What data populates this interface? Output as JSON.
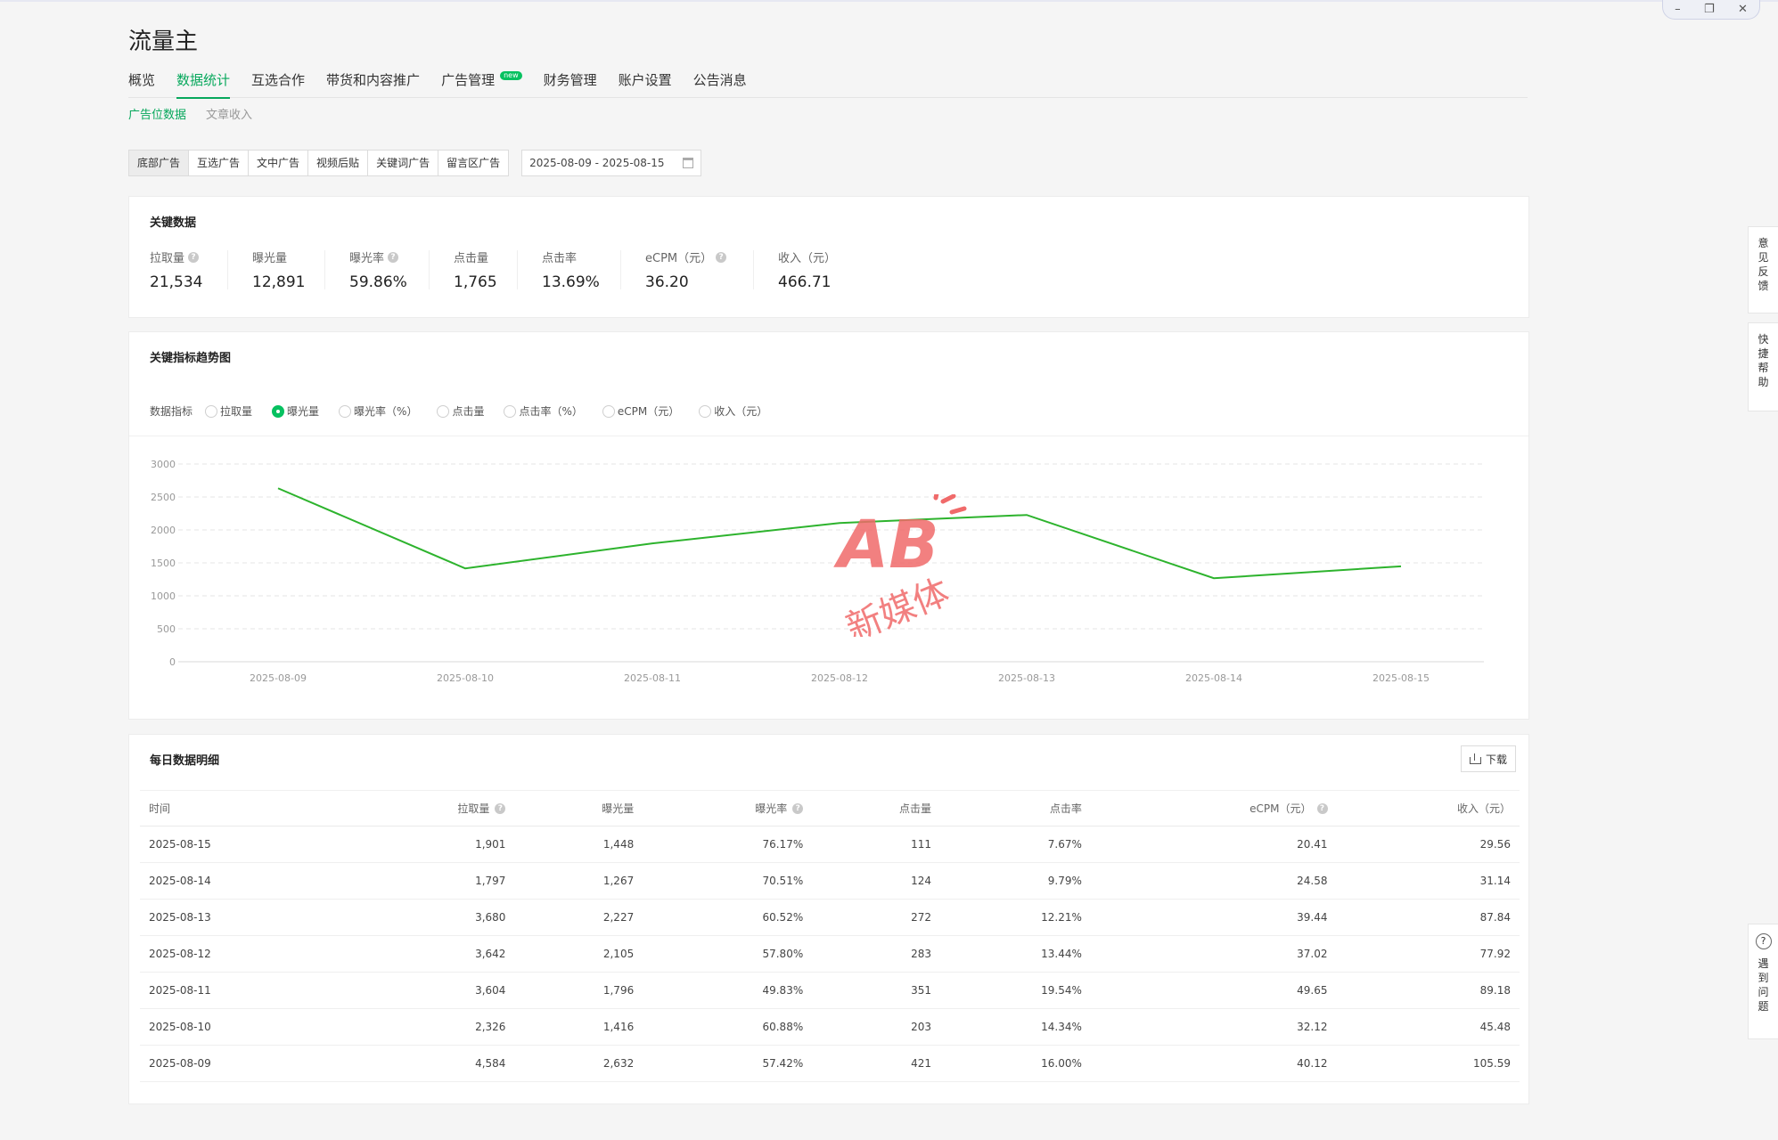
{
  "app": {
    "title": "流量主"
  },
  "main_tabs": [
    {
      "label": "概览",
      "active": false
    },
    {
      "label": "数据统计",
      "active": true
    },
    {
      "label": "互选合作",
      "active": false
    },
    {
      "label": "带货和内容推广",
      "active": false
    },
    {
      "label": "广告管理",
      "active": false,
      "badge": "new"
    },
    {
      "label": "财务管理",
      "active": false
    },
    {
      "label": "账户设置",
      "active": false
    },
    {
      "label": "公告消息",
      "active": false
    }
  ],
  "sub_tabs": [
    {
      "label": "广告位数据",
      "active": true
    },
    {
      "label": "文章收入",
      "active": false
    }
  ],
  "ad_types": [
    {
      "label": "底部广告",
      "active": true
    },
    {
      "label": "互选广告",
      "active": false
    },
    {
      "label": "文中广告",
      "active": false
    },
    {
      "label": "视频后贴",
      "active": false
    },
    {
      "label": "关键词广告",
      "active": false
    },
    {
      "label": "留言区广告",
      "active": false
    }
  ],
  "date_range": "2025-08-09 - 2025-08-15",
  "key_data": {
    "title": "关键数据",
    "items": [
      {
        "label": "拉取量",
        "value": "21,534",
        "help": true
      },
      {
        "label": "曝光量",
        "value": "12,891",
        "help": false
      },
      {
        "label": "曝光率",
        "value": "59.86%",
        "help": true
      },
      {
        "label": "点击量",
        "value": "1,765",
        "help": false
      },
      {
        "label": "点击率",
        "value": "13.69%",
        "help": false
      },
      {
        "label": "eCPM（元）",
        "value": "36.20",
        "help": true
      },
      {
        "label": "收入（元）",
        "value": "466.71",
        "help": false
      }
    ]
  },
  "trend": {
    "title": "关键指标趋势图",
    "metric_label": "数据指标",
    "metrics": [
      {
        "label": "拉取量",
        "checked": false
      },
      {
        "label": "曝光量",
        "checked": true
      },
      {
        "label": "曝光率（%）",
        "checked": false
      },
      {
        "label": "点击量",
        "checked": false
      },
      {
        "label": "点击率（%）",
        "checked": false
      },
      {
        "label": "eCPM（元）",
        "checked": false
      },
      {
        "label": "收入（元）",
        "checked": false
      }
    ]
  },
  "chart_data": {
    "type": "line",
    "x": [
      "2025-08-09",
      "2025-08-10",
      "2025-08-11",
      "2025-08-12",
      "2025-08-13",
      "2025-08-14",
      "2025-08-15"
    ],
    "series": [
      {
        "values": [
          2632,
          1416,
          1796,
          2105,
          2227,
          1267,
          1448
        ],
        "color": "#2db32d"
      }
    ],
    "yticks": [
      0,
      500,
      1000,
      1500,
      2000,
      2500,
      3000
    ],
    "ylim": [
      0,
      3000
    ],
    "grid": true,
    "legend": "none"
  },
  "daily": {
    "title": "每日数据明细",
    "download_label": "下载",
    "columns": [
      {
        "label": "时间",
        "help": false
      },
      {
        "label": "拉取量",
        "help": true
      },
      {
        "label": "曝光量",
        "help": false
      },
      {
        "label": "曝光率",
        "help": true
      },
      {
        "label": "点击量",
        "help": false
      },
      {
        "label": "点击率",
        "help": false
      },
      {
        "label": "eCPM（元）",
        "help": true
      },
      {
        "label": "收入（元）",
        "help": false
      }
    ],
    "rows": [
      [
        "2025-08-15",
        "1,901",
        "1,448",
        "76.17%",
        "111",
        "7.67%",
        "20.41",
        "29.56"
      ],
      [
        "2025-08-14",
        "1,797",
        "1,267",
        "70.51%",
        "124",
        "9.79%",
        "24.58",
        "31.14"
      ],
      [
        "2025-08-13",
        "3,680",
        "2,227",
        "60.52%",
        "272",
        "12.21%",
        "39.44",
        "87.84"
      ],
      [
        "2025-08-12",
        "3,642",
        "2,105",
        "57.80%",
        "283",
        "13.44%",
        "37.02",
        "77.92"
      ],
      [
        "2025-08-11",
        "3,604",
        "1,796",
        "49.83%",
        "351",
        "19.54%",
        "49.65",
        "89.18"
      ],
      [
        "2025-08-10",
        "2,326",
        "1,416",
        "60.88%",
        "203",
        "14.34%",
        "32.12",
        "45.48"
      ],
      [
        "2025-08-09",
        "4,584",
        "2,632",
        "57.42%",
        "421",
        "16.00%",
        "40.12",
        "105.59"
      ]
    ]
  },
  "side_tabs": {
    "feedback": [
      "意",
      "见",
      "反",
      "馈"
    ],
    "quick_help": [
      "快",
      "捷",
      "帮",
      "助"
    ],
    "problem": [
      "遇",
      "到",
      "问",
      "题"
    ]
  },
  "watermark": {
    "logo": "AB",
    "text": "新媒体"
  },
  "window_controls": {
    "minimize": "–",
    "maximize": "❐",
    "close": "✕"
  },
  "colors": {
    "accent": "#07a85c",
    "line": "#2db32d",
    "badge": "#07c160",
    "watermark": "#f06a6a"
  }
}
